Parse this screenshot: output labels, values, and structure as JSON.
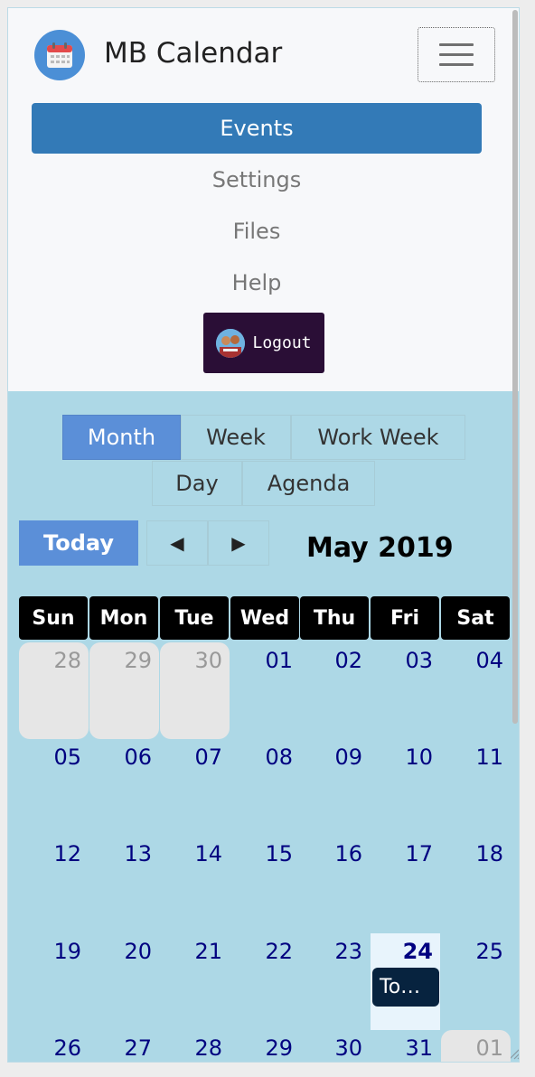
{
  "brand": {
    "title": "MB Calendar",
    "logo_icon": "calendar-icon"
  },
  "nav": {
    "toggler_icon": "hamburger-icon",
    "items": [
      {
        "label": "Events",
        "active": true
      },
      {
        "label": "Settings",
        "active": false
      },
      {
        "label": "Files",
        "active": false
      },
      {
        "label": "Help",
        "active": false
      }
    ],
    "logout_label": "Logout"
  },
  "views": {
    "month": "Month",
    "week": "Week",
    "work_week": "Work Week",
    "day": "Day",
    "agenda": "Agenda",
    "active": "Month"
  },
  "toolbar": {
    "today": "Today",
    "prev": "◀",
    "next": "▶",
    "month_label": "May 2019"
  },
  "calendar": {
    "weekdays": [
      "Sun",
      "Mon",
      "Tue",
      "Wed",
      "Thu",
      "Fri",
      "Sat"
    ],
    "weeks": [
      [
        "28",
        "29",
        "30",
        "01",
        "02",
        "03",
        "04"
      ],
      [
        "05",
        "06",
        "07",
        "08",
        "09",
        "10",
        "11"
      ],
      [
        "12",
        "13",
        "14",
        "15",
        "16",
        "17",
        "18"
      ],
      [
        "19",
        "20",
        "21",
        "22",
        "23",
        "24",
        "25"
      ],
      [
        "26",
        "27",
        "28",
        "29",
        "30",
        "31",
        "01"
      ]
    ],
    "today": "24",
    "events": [
      {
        "day": "24",
        "label": "To…"
      }
    ]
  },
  "colors": {
    "primary": "#337ab7",
    "background": "#add8e6",
    "header": "#000000",
    "event": "#07233f",
    "logout_bg": "#2a0e36"
  }
}
